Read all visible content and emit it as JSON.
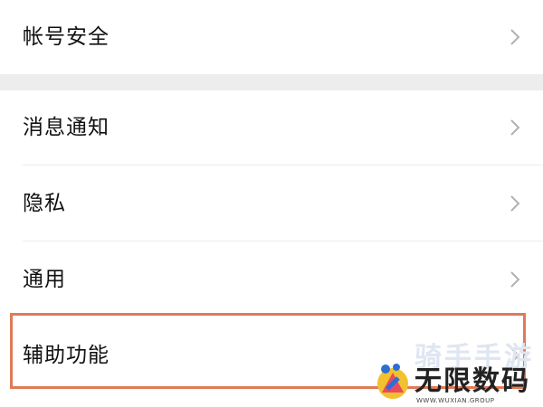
{
  "settings": {
    "items": [
      {
        "label": "帐号安全",
        "icon": "chevron-right-icon"
      },
      {
        "label": "消息通知",
        "icon": "chevron-right-icon"
      },
      {
        "label": "隐私",
        "icon": "chevron-right-icon"
      },
      {
        "label": "通用",
        "icon": "chevron-right-icon"
      },
      {
        "label": "辅助功能",
        "icon": "chevron-right-icon"
      }
    ]
  },
  "watermark": {
    "brand_top": "骑手手游",
    "brand_main": "无限数码",
    "brand_url": "WWW.WUXIAN.GROUP"
  },
  "colors": {
    "highlight": "#e07a57",
    "background": "#ededed",
    "row_background": "#ffffff",
    "chevron": "#b2b2b2"
  }
}
